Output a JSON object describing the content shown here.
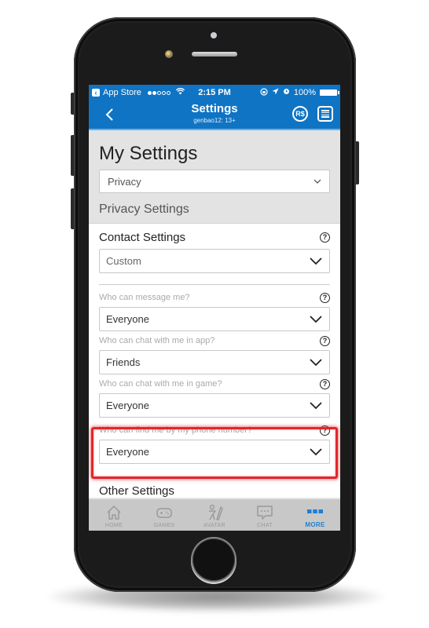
{
  "status_bar": {
    "back_app": "App Store",
    "time": "2:15 PM",
    "battery": "100%",
    "signal_filled": 2,
    "signal_total": 5
  },
  "nav": {
    "title": "Settings",
    "subtitle": "genbao12: 13+",
    "robux_label": "R$"
  },
  "page": {
    "title": "My Settings",
    "category_value": "Privacy",
    "section_title": "Privacy Settings"
  },
  "contact_settings": {
    "title": "Contact Settings",
    "value": "Custom",
    "fields": [
      {
        "label": "Who can message me?",
        "value": "Everyone"
      },
      {
        "label": "Who can chat with me in app?",
        "value": "Friends"
      },
      {
        "label": "Who can chat with me in game?",
        "value": "Everyone"
      },
      {
        "label": "Who can find me by my phone number?",
        "value": "Everyone"
      }
    ]
  },
  "other_settings_title": "Other Settings",
  "tabbar": {
    "items": [
      {
        "label": "HOME",
        "icon": "home-icon"
      },
      {
        "label": "GAMES",
        "icon": "gamepad-icon"
      },
      {
        "label": "AVATAR",
        "icon": "avatar-icon"
      },
      {
        "label": "CHAT",
        "icon": "chat-icon"
      },
      {
        "label": "MORE",
        "icon": "more-icon",
        "active": true
      }
    ]
  },
  "colors": {
    "brand_blue": "#0f74c4",
    "highlight_red": "#e3262b",
    "active_tab": "#1c7fd4"
  }
}
